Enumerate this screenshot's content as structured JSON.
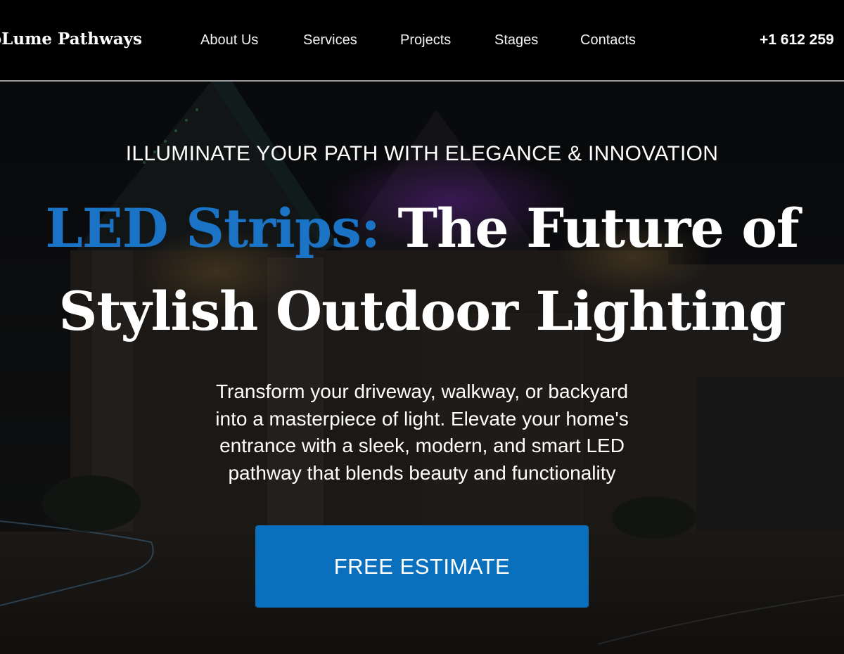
{
  "header": {
    "brand": "uroLume Pathways",
    "nav": [
      {
        "label": "About Us"
      },
      {
        "label": "Services"
      },
      {
        "label": "Projects"
      },
      {
        "label": "Stages"
      },
      {
        "label": "Contacts"
      }
    ],
    "phone": "+1 612 259"
  },
  "hero": {
    "eyebrow": "ILLUMINATE YOUR PATH WITH ELEGANCE & INNOVATION",
    "headline_accent": "LED Strips:",
    "headline_rest": " The Future of",
    "headline_line2": "Stylish Outdoor Lighting",
    "lead_lines": [
      "Transform your driveway, walkway, or backyard",
      "into a masterpiece of light. Elevate your home's",
      "entrance with a sleek, modern, and smart LED",
      "pathway that blends beauty and functionality"
    ],
    "cta_label": "FREE ESTIMATE"
  },
  "colors": {
    "accent": "#1a73c4",
    "cta_background": "#0a6fbd",
    "header_background": "#000000"
  }
}
